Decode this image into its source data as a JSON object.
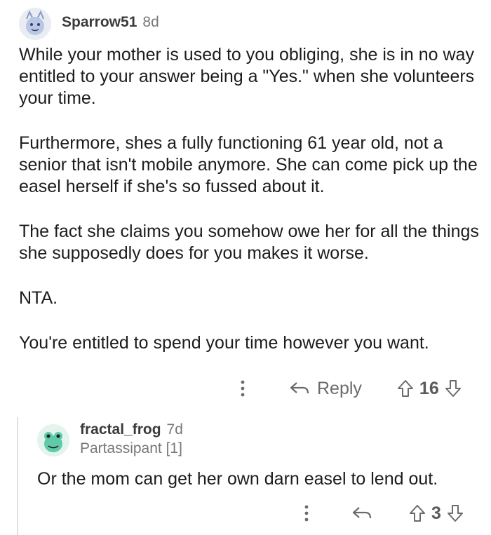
{
  "comment": {
    "username": "Sparrow51",
    "age": "8d",
    "paragraphs": [
      "While your mother is used to you obliging, she is in no way entitled to your answer being a \"Yes.\" when she volunteers your time.",
      "Furthermore, shes a fully functioning 61 year old, not a senior that isn't mobile anymore. She can come pick up the easel herself if she's so fussed about it.",
      "The fact she claims you somehow owe her for all the things she supposedly does for you makes it worse.",
      "NTA.",
      "You're entitled to spend your time however you want."
    ],
    "actions": {
      "reply_label": "Reply",
      "vote_count": "16"
    }
  },
  "reply": {
    "username": "fractal_frog",
    "age": "7d",
    "flair": "Partassipant [1]",
    "text": "Or the mom can get her own darn easel to lend out.",
    "actions": {
      "vote_count": "3"
    }
  },
  "icons": {
    "more": "more-vertical-icon",
    "reply": "reply-arrow-icon",
    "upvote": "upvote-arrow-icon",
    "downvote": "downvote-arrow-icon"
  },
  "colors": {
    "text": "#1c1c1c",
    "meta": "#777777",
    "action": "#6b6b6b",
    "frog_avatar": "#5fc9a8"
  }
}
